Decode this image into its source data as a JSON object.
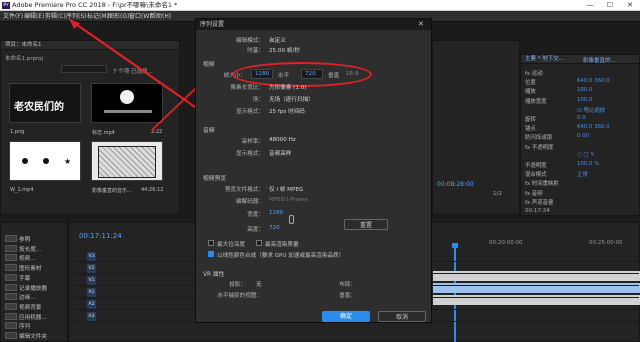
{
  "window": {
    "title": "Adobe Premiere Pro CC 2018 - F:\\pr不哪嘛\\未命名1 *",
    "logo": "Pr",
    "controls": [
      "—",
      "☐",
      "✕"
    ]
  },
  "menu": [
    "文件(F)",
    "编辑(E)",
    "剪辑(C)",
    "序列(S)",
    "标记(M)",
    "图形(G)",
    "窗口(W)",
    "帮助(H)"
  ],
  "left_panel": {
    "tab": "项目：未命名1",
    "breadcrumb": "未命名1.prproj",
    "item_count": "7 个项 已选择...",
    "thumbs": [
      {
        "name": "1.png",
        "caption": "老农民们的",
        "duration": ""
      },
      {
        "name": "标志.mp4",
        "caption": "",
        "duration": "2:22"
      },
      {
        "name": "W_1.mp4",
        "caption": "",
        "duration": "0:00"
      },
      {
        "name": "影像垂直的音乐...",
        "caption": "",
        "duration": "44:26:12"
      }
    ]
  },
  "dialog": {
    "title": "序列设置",
    "rows": [
      {
        "label": "编辑模式：",
        "value": "自定义"
      },
      {
        "label": "时基：",
        "value": "25.00 帧/秒"
      }
    ],
    "video_section": "视频",
    "frame_size_label": "帧大小：",
    "frame_w": "1280",
    "frame_h_label": "水平",
    "frame_h": "720",
    "vertical_label": "垂直",
    "ratio": "16:9",
    "pixel_aspect_label": "像素长宽比：",
    "pixel_aspect": "方形像素 (1.0)",
    "field_label": "场：",
    "field": "无场（逐行扫描）",
    "display_format_label": "显示格式：",
    "display_format": "25 fps 时间码",
    "audio_section": "音频",
    "sample_rate_label": "采样率：",
    "sample_rate": "48000 Hz",
    "audio_display_label": "显示格式：",
    "audio_display": "音频采样",
    "preview_section": "视频预览",
    "preview_format_label": "预览文件格式：",
    "preview_format": "仅 I 帧 MPEG",
    "codec_label": "编解码器：",
    "codec": "MPEG I-Frame",
    "width_label": "宽度：",
    "width": "1280",
    "height_label": "高度：",
    "height": "720",
    "reset_button": "重置",
    "max_depth": "最大位深度",
    "max_quality": "最高渲染质量",
    "linear_color": "以线性颜色合成（要求 GPU 加速或最高渲染品质）",
    "vr_section": "VR 属性",
    "projection_label": "投影：",
    "projection": "无",
    "layout_label": "布局：",
    "h_fov_label": "水平捕捉的视图：",
    "v_label": "垂直：",
    "ok_button": "确定",
    "cancel_button": "取消"
  },
  "program_monitor": {
    "timecode": "00:08:28:00",
    "zoom": "1/2"
  },
  "effects_panel": {
    "tab": "主要 * 地下交...",
    "tab2": "影像垂直的...",
    "rows": [
      {
        "label": "fx 运动",
        "value": ""
      },
      {
        "label": "位置",
        "value": "640.0   360.0"
      },
      {
        "label": "缩放",
        "value": "100.0"
      },
      {
        "label": "缩放宽度",
        "value": "100.0"
      },
      {
        "label": "",
        "value": "☑ 等比缩放"
      },
      {
        "label": "旋转",
        "value": "0.0"
      },
      {
        "label": "锚点",
        "value": "640.0  360.0"
      },
      {
        "label": "防闪烁滤镜",
        "value": "0.00"
      },
      {
        "label": "fx 不透明度",
        "value": ""
      },
      {
        "label": "",
        "value": "○ □ ✎"
      },
      {
        "label": "不透明度",
        "value": "100.0 %"
      },
      {
        "label": "混合模式",
        "value": "正常"
      },
      {
        "label": "fx 时间重映射",
        "value": ""
      },
      {
        "label": "fx 音频",
        "value": ""
      },
      {
        "label": "fx 声道音量",
        "value": ""
      }
    ],
    "timecode": "00:17:24"
  },
  "timeline": {
    "timecode": "00:17:11:24",
    "ruler": [
      "00:20:00:00",
      "00:25:00:00"
    ],
    "tracks": [
      "V3",
      "V2",
      "V1",
      "A1",
      "A2",
      "A3"
    ]
  },
  "bottom_project": {
    "items": [
      "参照",
      "按长度...",
      "视频...",
      "图形素材",
      "字幕",
      "记录播放器",
      "边缘...",
      "视频背景",
      "应用机器...",
      "序列",
      "编辑文件夹"
    ]
  },
  "colors": {
    "accent": "#2d8ceb",
    "highlight": "#e12127"
  }
}
